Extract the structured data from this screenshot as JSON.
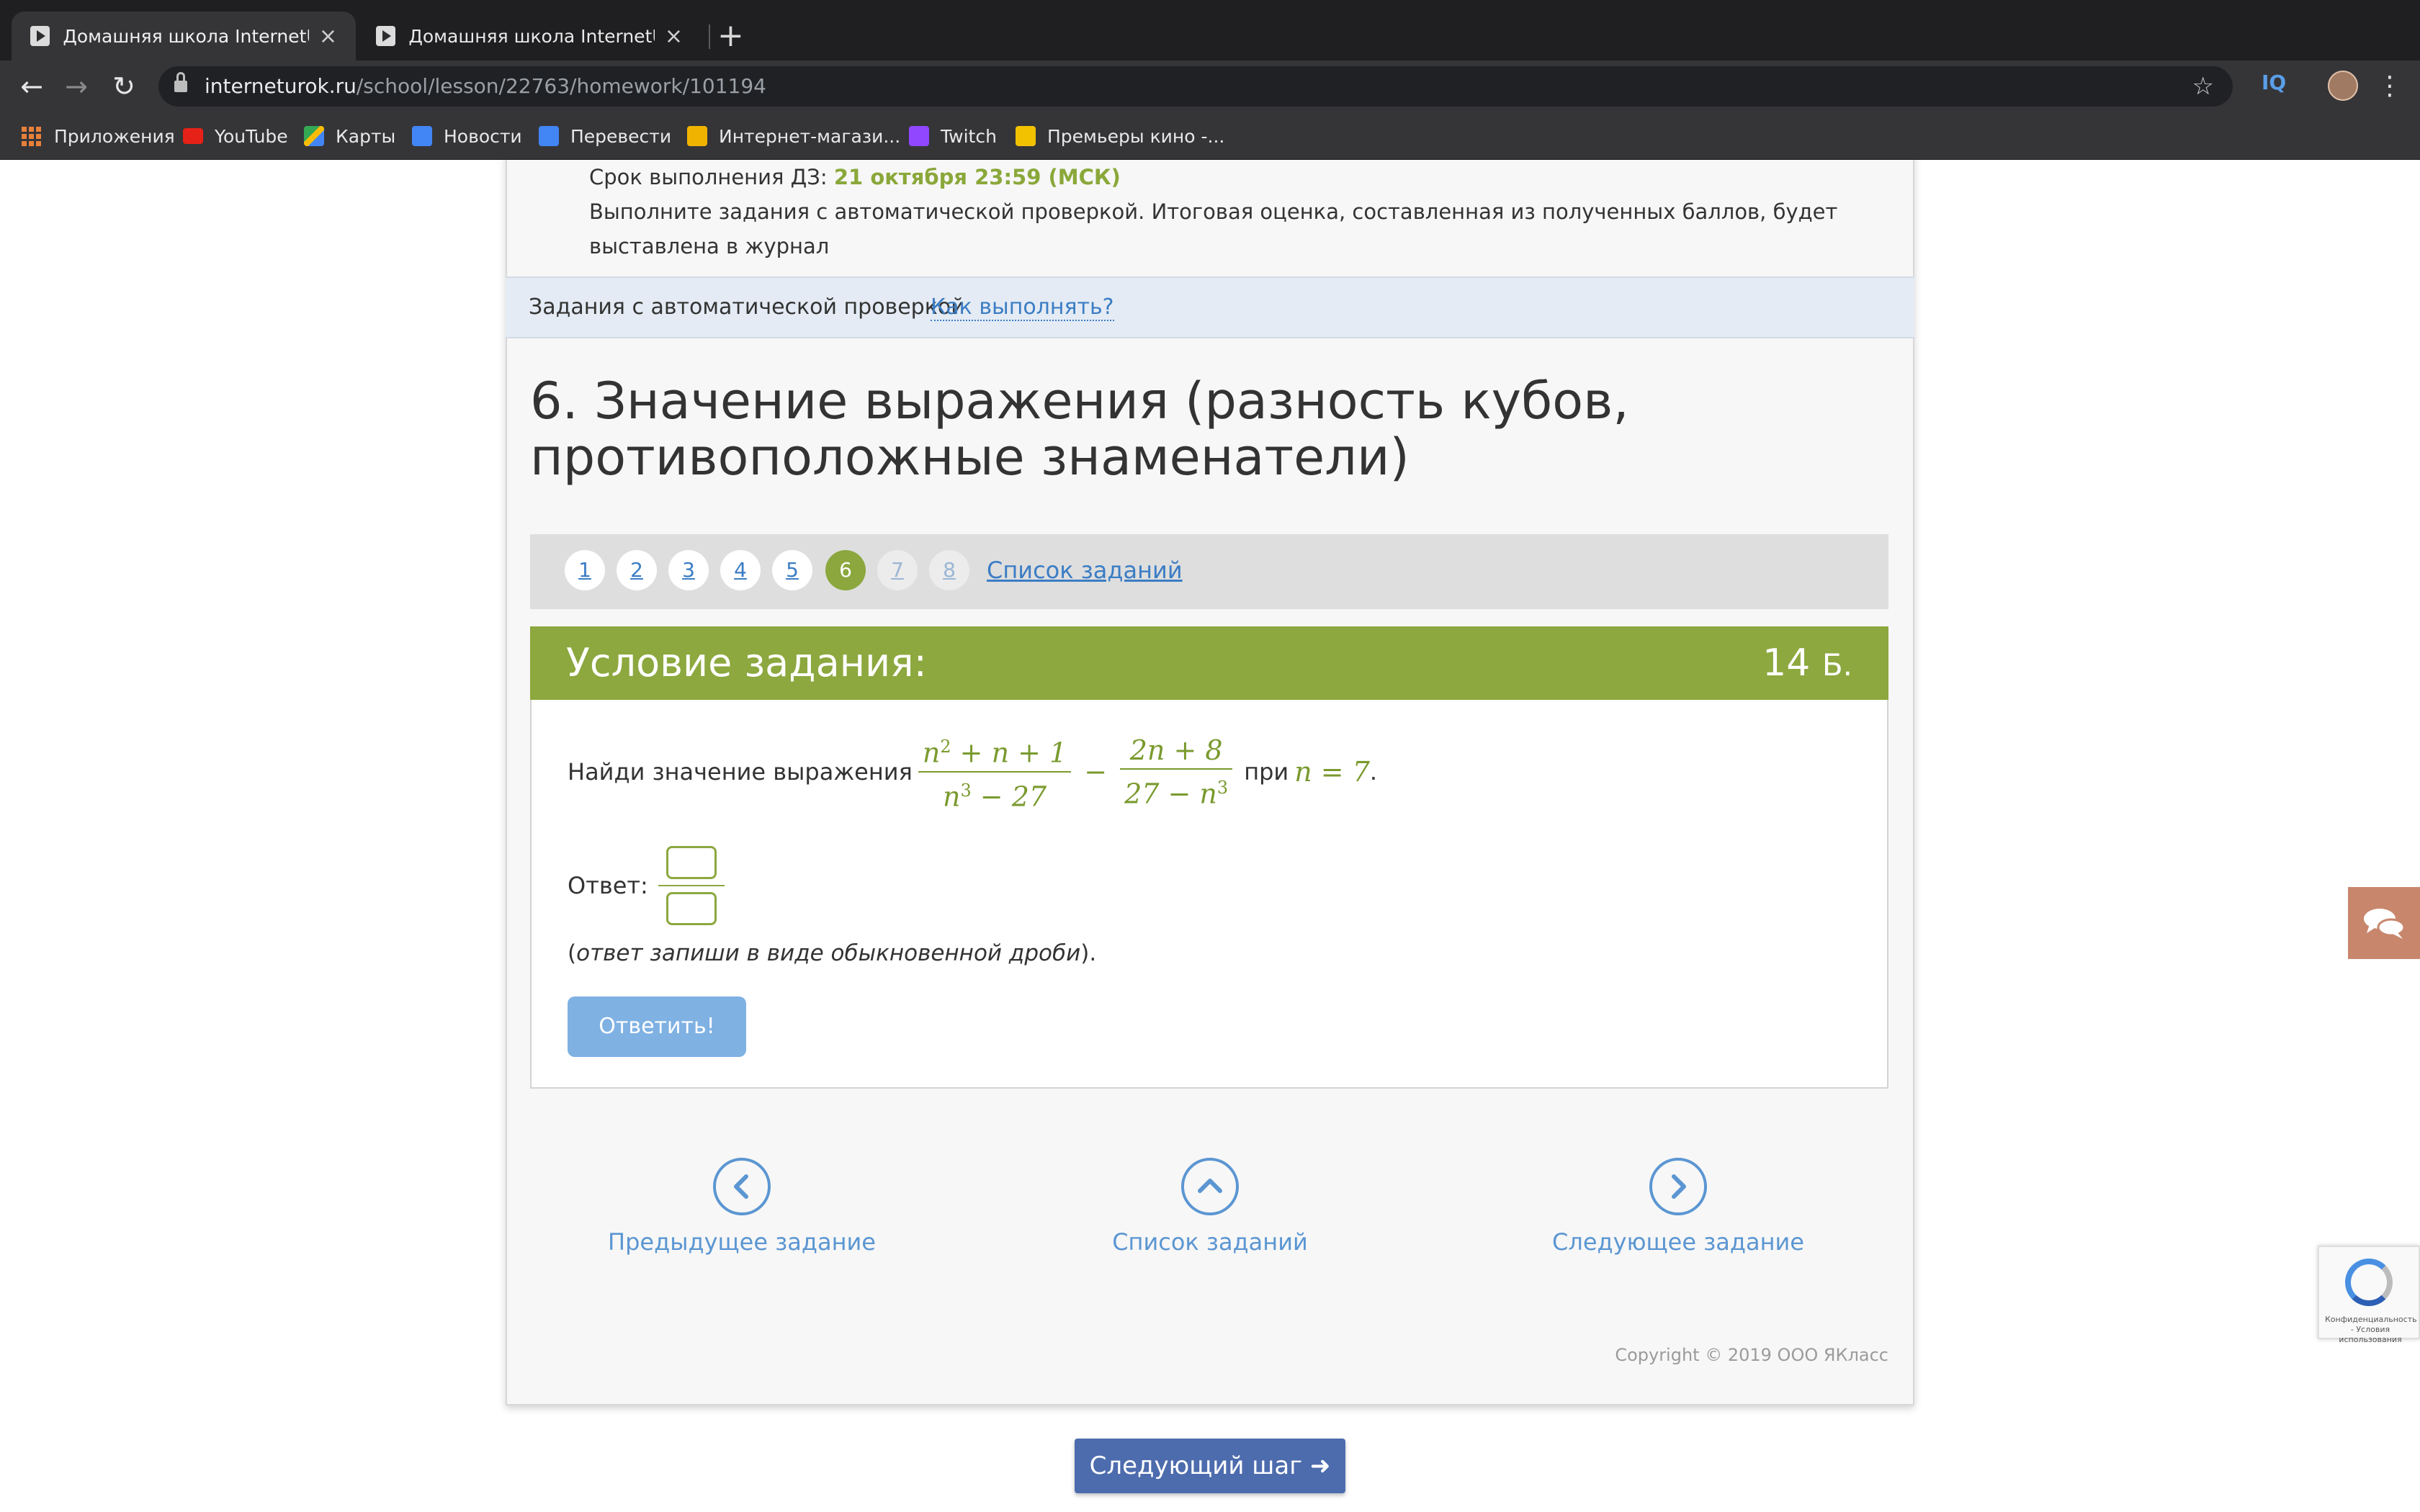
{
  "browser": {
    "tabs": [
      {
        "label": "Домашняя школа InternetUrok.r",
        "close": "×"
      },
      {
        "label": "Домашняя школа InternetUrok.r",
        "close": "×"
      }
    ],
    "new_tab": "+",
    "url_host": "interneturok.ru",
    "url_path": "/school/lesson/22763/homework/101194",
    "ext_label": "IQ",
    "bookmarks": [
      {
        "label": "Приложения",
        "icon": "apps-grid-icon"
      },
      {
        "label": "YouTube",
        "icon": "youtube-icon",
        "color": "#e62117"
      },
      {
        "label": "Карты",
        "icon": "maps-icon",
        "color": "#34a853"
      },
      {
        "label": "Новости",
        "icon": "google-news-icon",
        "color": "#4285f4"
      },
      {
        "label": "Перевести",
        "icon": "google-translate-icon",
        "color": "#4285f4"
      },
      {
        "label": "Интернет-магази...",
        "icon": "shop-icon",
        "color": "#f0b400"
      },
      {
        "label": "Twitch",
        "icon": "twitch-icon",
        "color": "#9146ff"
      },
      {
        "label": "Премьеры кино -...",
        "icon": "cinema-icon",
        "color": "#f2c200"
      }
    ]
  },
  "homework": {
    "deadline_label": "Срок выполнения ДЗ: ",
    "deadline_date": "21 октября 23:59 (МСК)",
    "instructions": "Выполните задания с автоматической проверкой. Итоговая оценка, составленная из полученных баллов, будет выставлена в журнал",
    "auto_label": "Задания с автоматической проверкой",
    "how_link": "Как выполнять?"
  },
  "task": {
    "title": "6. Значение выражения (разность кубов, противоположные знаменатели)",
    "pages": [
      "1",
      "2",
      "3",
      "4",
      "5",
      "6",
      "7",
      "8"
    ],
    "active_page": "6",
    "list_link": "Список заданий",
    "condition_title": "Условие задания:",
    "points_value": "14",
    "points_unit": "Б.",
    "question_prefix": "Найди значение выражения",
    "frac1_num": "n",
    "frac1_num_exp": "2",
    "frac1_num_rest": " + n + 1",
    "frac1_den": "n",
    "frac1_den_exp": "3",
    "frac1_den_rest": " − 27",
    "minus": "−",
    "frac2_num": "2n + 8",
    "frac2_den_pre": "27 − n",
    "frac2_den_exp": "3",
    "question_at": "при",
    "condition_expr": "n = 7",
    "period": ".",
    "answer_label": "Ответ:",
    "hint_open": "(",
    "hint_text": "ответ запиши в виде обыкновенной дроби",
    "hint_close": ").",
    "submit_label": "Ответить!"
  },
  "nav": {
    "prev": "Предыдущее задание",
    "list": "Список заданий",
    "next": "Следующее задание"
  },
  "footer": {
    "copyright": "Copyright © 2019 ООО ЯКласс",
    "next_step": "Следующий шаг"
  },
  "recaptcha": {
    "caption": "Конфиденциальность - Условия использования"
  }
}
